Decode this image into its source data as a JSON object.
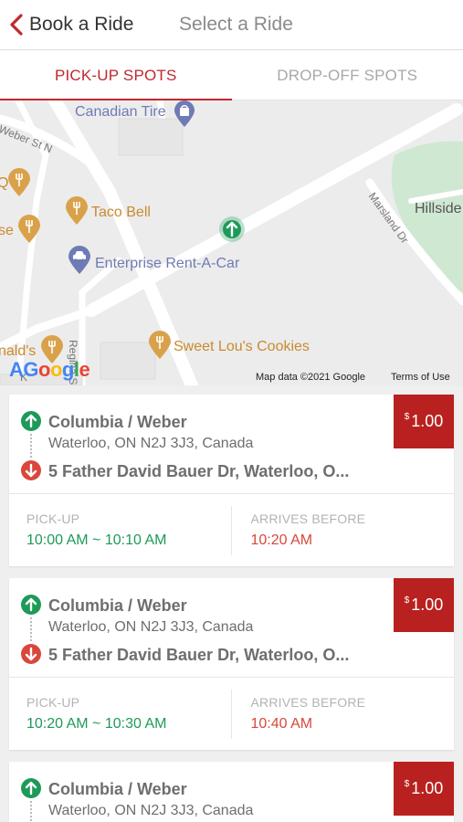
{
  "header": {
    "back_label": "Book a Ride",
    "title": "Select a Ride"
  },
  "tabs": [
    {
      "label": "PICK-UP SPOTS",
      "active": true
    },
    {
      "label": "DROP-OFF SPOTS",
      "active": false
    }
  ],
  "map": {
    "labels": {
      "canadian_tire": "Canadian Tire",
      "weber_st": "Weber St N",
      "taco_bell": "Taco Bell",
      "enterprise": "Enterprise Rent-A-Car",
      "sweet_lous": "Sweet Lou's Cookies",
      "mcdonalds_partial": "nald's",
      "left_q": "Q",
      "left_se": "se",
      "hillside": "Hillside",
      "marsland": "Marsland Dr",
      "regina": "Regina St N",
      "k_partial": "K"
    },
    "attribution": "Map data ©2021 Google",
    "terms": "Terms of Use",
    "google_logo": "Google"
  },
  "rides": [
    {
      "from_name": "Columbia / Weber",
      "from_address": "Waterloo, ON N2J 3J3, Canada",
      "to_address": "5 Father David Bauer Dr, Waterloo, O...",
      "price_currency": "$",
      "price_amount": "1.00",
      "pickup_label": "PICK-UP",
      "pickup_window": "10:00 AM ~ 10:10 AM",
      "arrives_label": "ARRIVES BEFORE",
      "arrives_time": "10:20 AM"
    },
    {
      "from_name": "Columbia / Weber",
      "from_address": "Waterloo, ON N2J 3J3, Canada",
      "to_address": "5 Father David Bauer Dr, Waterloo, O...",
      "price_currency": "$",
      "price_amount": "1.00",
      "pickup_label": "PICK-UP",
      "pickup_window": "10:20 AM ~ 10:30 AM",
      "arrives_label": "ARRIVES BEFORE",
      "arrives_time": "10:40 AM"
    },
    {
      "from_name": "Columbia / Weber",
      "from_address": "Waterloo, ON N2J 3J3, Canada",
      "price_currency": "$",
      "price_amount": "1.00"
    }
  ],
  "colors": {
    "brand_red": "#c0282d",
    "price_red": "#b8211f",
    "pickup_green": "#1d9a58",
    "arrive_red": "#d9473c"
  }
}
